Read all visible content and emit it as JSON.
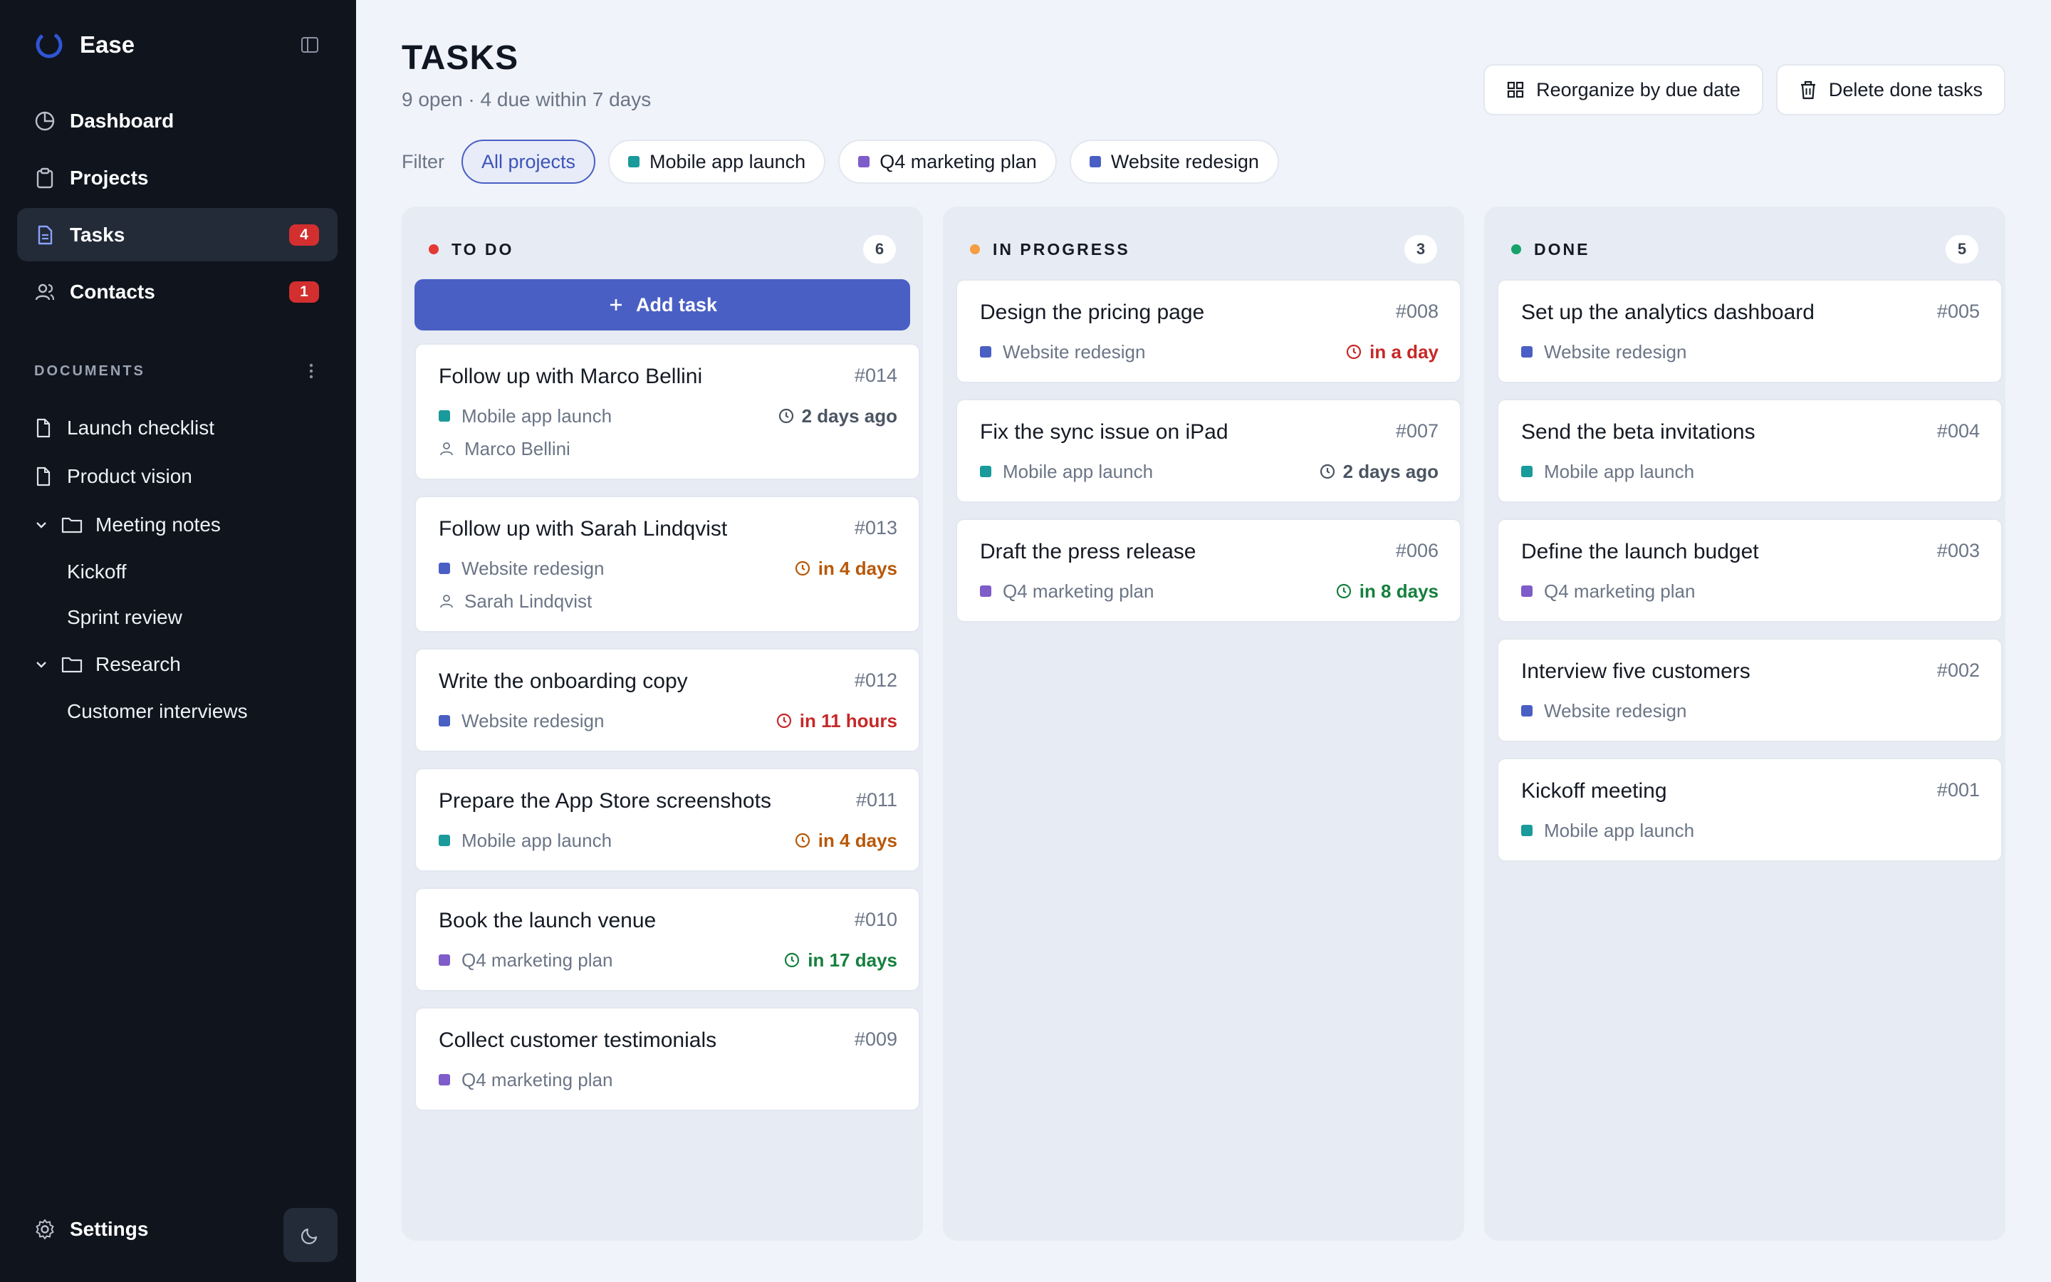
{
  "app": {
    "name": "Ease"
  },
  "nav": [
    {
      "label": "Dashboard",
      "icon": "dashboard-icon",
      "badge": ""
    },
    {
      "label": "Projects",
      "icon": "clipboard-icon",
      "badge": ""
    },
    {
      "label": "Tasks",
      "icon": "document-icon",
      "badge": "4",
      "active": true
    },
    {
      "label": "Contacts",
      "icon": "users-icon",
      "badge": "1"
    }
  ],
  "documents": {
    "title": "DOCUMENTS",
    "items": [
      {
        "label": "Launch checklist"
      },
      {
        "label": "Product vision"
      }
    ],
    "folders": [
      {
        "label": "Meeting notes",
        "children": [
          "Kickoff",
          "Sprint review"
        ]
      },
      {
        "label": "Research",
        "children": [
          "Customer interviews"
        ]
      }
    ]
  },
  "footer": {
    "settings_label": "Settings"
  },
  "page": {
    "title": "TASKS",
    "subtitle": "9 open · 4 due within 7 days",
    "actions": {
      "reorganize": "Reorganize by due date",
      "delete_done": "Delete done tasks"
    }
  },
  "filter": {
    "label": "Filter",
    "chips": [
      {
        "label": "All projects",
        "active": true,
        "color": ""
      },
      {
        "label": "Mobile app launch",
        "color": "#1a9a9a"
      },
      {
        "label": "Q4 marketing plan",
        "color": "#7e5cc9"
      },
      {
        "label": "Website redesign",
        "color": "#4a5fc4"
      }
    ]
  },
  "project_colors": {
    "Mobile app launch": "#1a9a9a",
    "Q4 marketing plan": "#7e5cc9",
    "Website redesign": "#4a5fc4"
  },
  "status_colors": {
    "todo": "#e53935",
    "in_progress": "#f59e42",
    "done": "#16a36a"
  },
  "columns": {
    "todo": {
      "title": "TO DO",
      "count": "6",
      "add_label": "Add task",
      "cards": [
        {
          "title": "Follow up with Marco Bellini",
          "id": "#014",
          "project": "Mobile app launch",
          "due": "2 days ago",
          "due_tone": "gray",
          "assignee": "Marco Bellini"
        },
        {
          "title": "Follow up with Sarah Lindqvist",
          "id": "#013",
          "project": "Website redesign",
          "due": "in 4 days",
          "due_tone": "orange",
          "assignee": "Sarah Lindqvist"
        },
        {
          "title": "Write the onboarding copy",
          "id": "#012",
          "project": "Website redesign",
          "due": "in 11 hours",
          "due_tone": "red"
        },
        {
          "title": "Prepare the App Store screenshots",
          "id": "#011",
          "project": "Mobile app launch",
          "due": "in 4 days",
          "due_tone": "orange"
        },
        {
          "title": "Book the launch venue",
          "id": "#010",
          "project": "Q4 marketing plan",
          "due": "in 17 days",
          "due_tone": "green"
        },
        {
          "title": "Collect customer testimonials",
          "id": "#009",
          "project": "Q4 marketing plan"
        }
      ]
    },
    "in_progress": {
      "title": "IN PROGRESS",
      "count": "3",
      "cards": [
        {
          "title": "Design the pricing page",
          "id": "#008",
          "project": "Website redesign",
          "due": "in a day",
          "due_tone": "red"
        },
        {
          "title": "Fix the sync issue on iPad",
          "id": "#007",
          "project": "Mobile app launch",
          "due": "2 days ago",
          "due_tone": "gray"
        },
        {
          "title": "Draft the press release",
          "id": "#006",
          "project": "Q4 marketing plan",
          "due": "in 8 days",
          "due_tone": "green"
        }
      ]
    },
    "done": {
      "title": "DONE",
      "count": "5",
      "cards": [
        {
          "title": "Set up the analytics dashboard",
          "id": "#005",
          "project": "Website redesign"
        },
        {
          "title": "Send the beta invitations",
          "id": "#004",
          "project": "Mobile app launch"
        },
        {
          "title": "Define the launch budget",
          "id": "#003",
          "project": "Q4 marketing plan"
        },
        {
          "title": "Interview five customers",
          "id": "#002",
          "project": "Website redesign"
        },
        {
          "title": "Kickoff meeting",
          "id": "#001",
          "project": "Mobile app launch"
        }
      ]
    }
  }
}
